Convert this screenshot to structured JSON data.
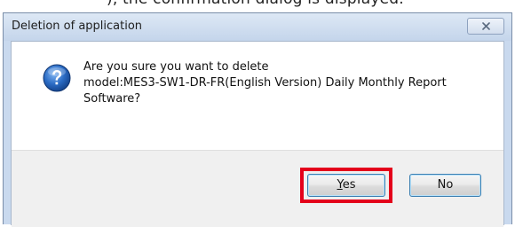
{
  "background_text": "), the confirmation dialog is displayed.",
  "dialog": {
    "title": "Deletion of application",
    "close_icon": "close-icon",
    "question_icon": "question-icon",
    "message_lines": [
      "Are you sure you want to delete",
      "model:MES3-SW1-DR-FR(English Version) Daily Monthly Report",
      "Software?"
    ],
    "buttons": {
      "yes_mnemonic": "Y",
      "yes_rest": "es",
      "no_label": "No"
    },
    "colors": {
      "highlight": "#e4001b",
      "icon_blue": "#2a6bc4"
    }
  }
}
